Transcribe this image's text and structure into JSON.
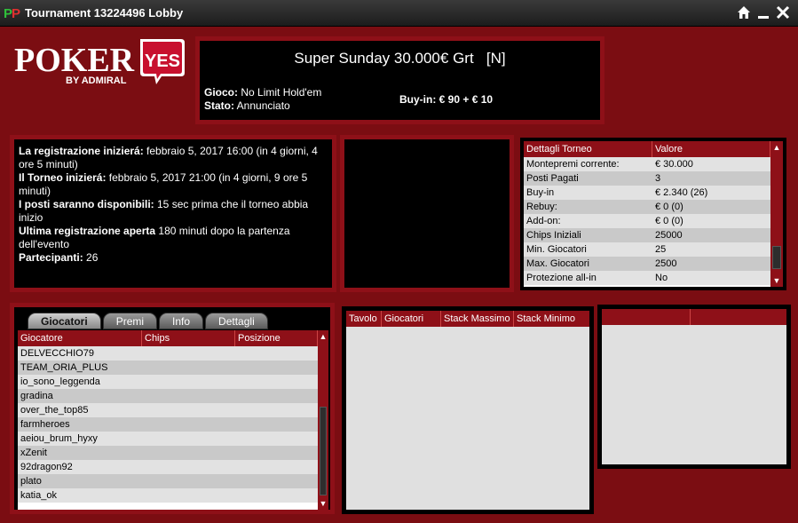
{
  "window": {
    "title": "Tournament 13224496 Lobby"
  },
  "logo": {
    "brand": "POKER",
    "badge": "YES",
    "byline": "BY ADMIRAL"
  },
  "header": {
    "name": "Super Sunday 30.000€ Grt",
    "tag": "[N]",
    "game_label": "Gioco:",
    "game_value": "No Limit Hold'em",
    "status_label": "Stato:",
    "status_value": "Annunciato",
    "buyin_label": "Buy-in:",
    "buyin_value": "€ 90 + € 10"
  },
  "schedule": [
    {
      "label": "La registrazione inizierá:",
      "value": " febbraio 5, 2017 16:00 (in 4 giorni, 4 ore 5 minuti)"
    },
    {
      "label": "Il Torneo inizierá:",
      "value": " febbraio 5, 2017 21:00 (in 4 giorni, 9 ore 5 minuti)"
    },
    {
      "label": "I posti saranno disponibili:",
      "value": " 15 sec prima che il torneo abbia inizio"
    },
    {
      "label": "Ultima registrazione aperta",
      "value": " 180 minuti dopo la partenza dell'evento"
    },
    {
      "label": "Partecipanti:",
      "value": " 26"
    }
  ],
  "details": {
    "headers": [
      "Dettagli Torneo",
      "Valore"
    ],
    "rows": [
      [
        "Montepremi corrente:",
        "€ 30.000"
      ],
      [
        "Posti Pagati",
        "3"
      ],
      [
        "Buy-in",
        "€ 2.340 (26)"
      ],
      [
        "Rebuy:",
        "€ 0 (0)"
      ],
      [
        "Add-on:",
        "€ 0 (0)"
      ],
      [
        "Chips Iniziali",
        "25000"
      ],
      [
        "Min. Giocatori",
        "25"
      ],
      [
        "Max. Giocatori",
        "2500"
      ],
      [
        "Protezione all-in",
        "No"
      ]
    ]
  },
  "tabs": [
    "Giocatori",
    "Premi",
    "Info",
    "Dettagli"
  ],
  "players": {
    "headers": [
      "Giocatore",
      "Chips",
      "Posizione"
    ],
    "rows": [
      "DELVECCHIO79",
      "TEAM_ORIA_PLUS",
      "io_sono_leggenda",
      "gradina",
      "over_the_top85",
      "farmheroes",
      "aeiou_brum_hyxy",
      "xZenit",
      "92dragon92",
      "plato",
      "katia_ok"
    ]
  },
  "tables": {
    "headers": [
      "Tavolo",
      "Giocatori",
      "Stack Massimo",
      "Stack Minimo"
    ]
  },
  "icons": {
    "home": "home-icon",
    "minimize": "minimize-icon",
    "close": "close-icon",
    "up": "arrow-up-icon",
    "down": "arrow-down-icon"
  },
  "colors": {
    "accent": "#8e1018",
    "frame": "#7b0d12",
    "panel": "#000000",
    "grid_odd": "#e2e2e2",
    "grid_even": "#c9c9c9"
  }
}
